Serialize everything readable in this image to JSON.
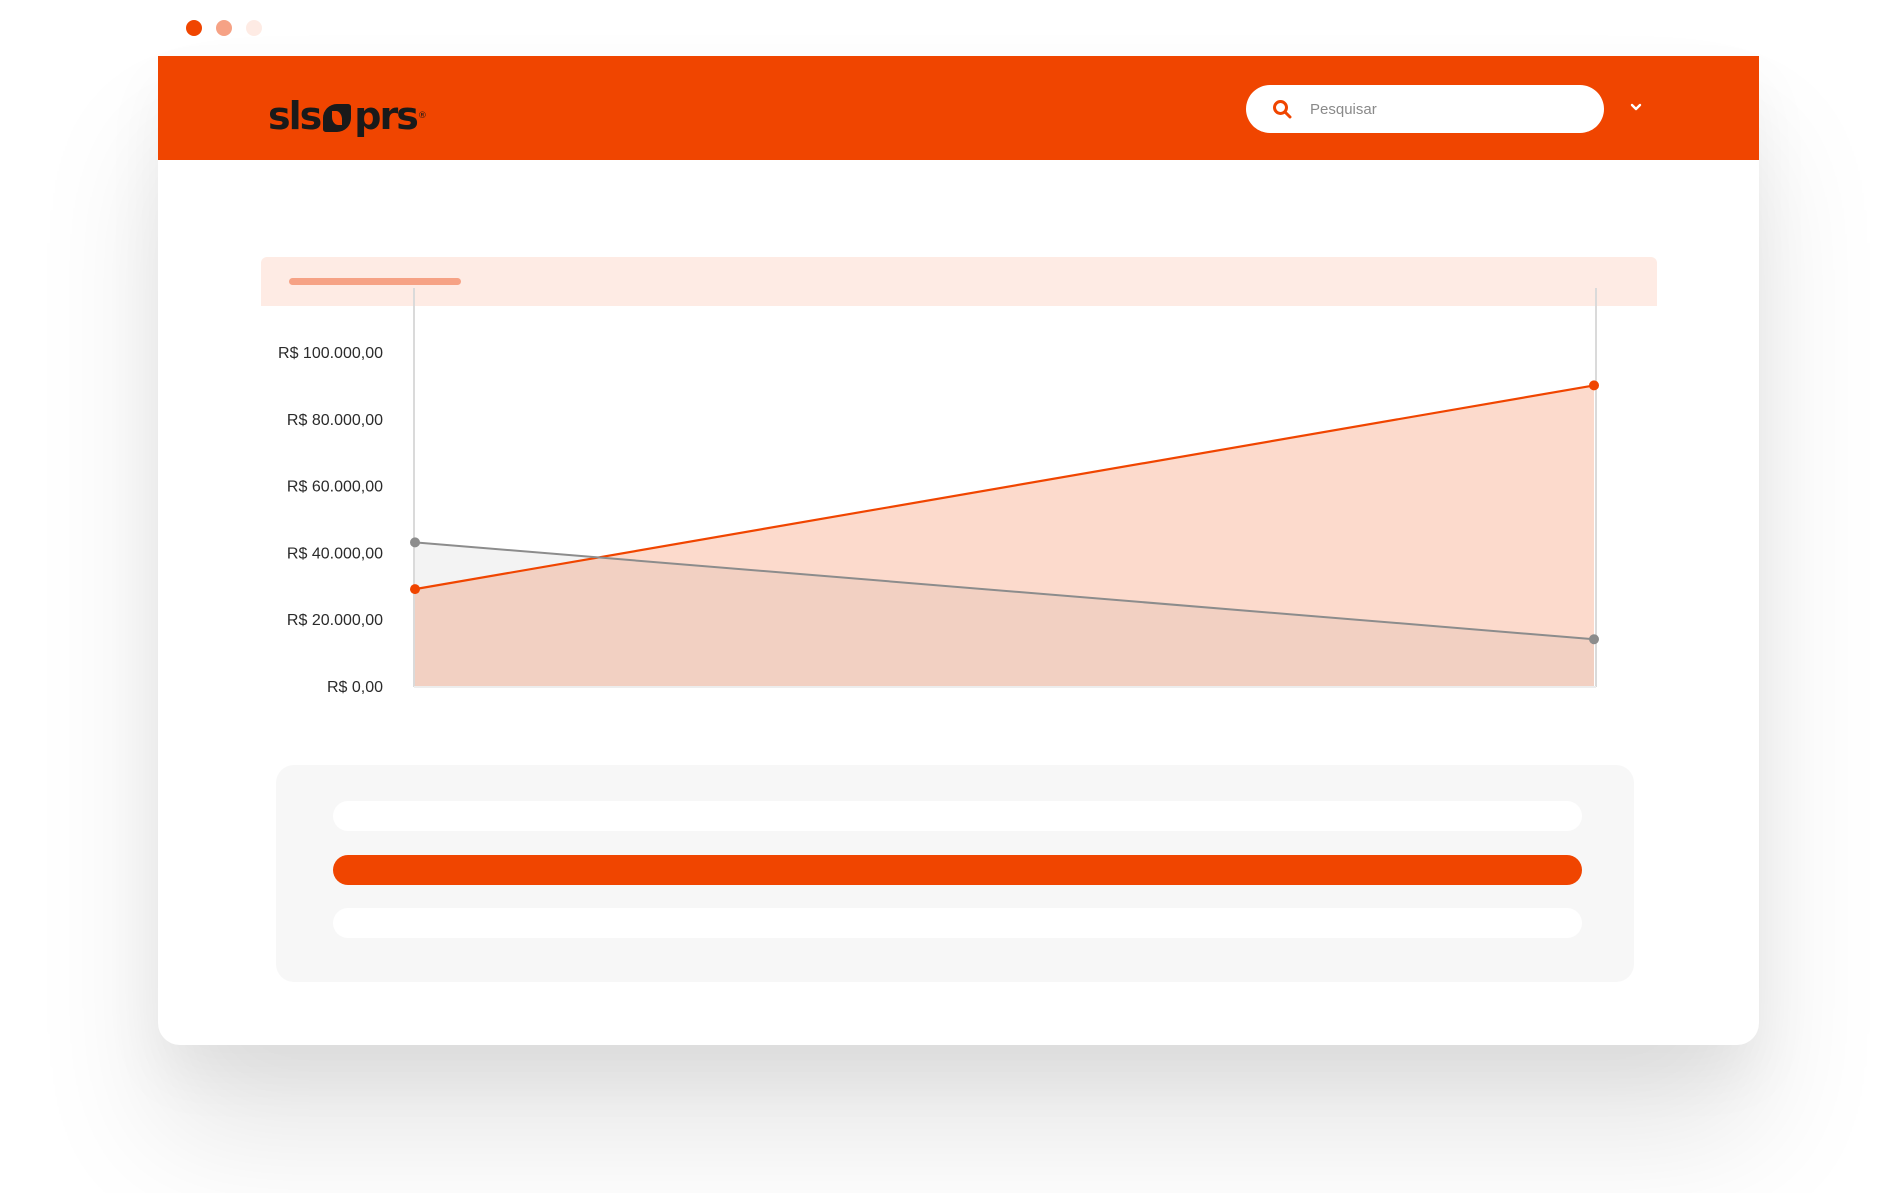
{
  "window_controls": [
    {
      "name": "close",
      "color": "#F04500"
    },
    {
      "name": "minimize",
      "color": "#F6A285"
    },
    {
      "name": "maximize",
      "color": "#FEEBE4"
    }
  ],
  "colors": {
    "brand": "#F04500",
    "brand_light": "#FEEBE4",
    "brand_mid": "#F6A285",
    "series_gray": "#8C8C8C"
  },
  "header": {
    "logo": {
      "part1": "sls",
      "part2": "prs",
      "reg": "®"
    },
    "search": {
      "placeholder": "Pesquisar",
      "icon": "search-icon"
    },
    "menu_icon": "chevron-down-icon"
  },
  "chart_data": {
    "type": "area",
    "x": [
      0,
      1
    ],
    "yticks": [
      "R$ 100.000,00",
      "R$ 80.000,00",
      "R$ 60.000,00",
      "R$ 40.000,00",
      "R$ 20.000,00",
      "R$ 0,00"
    ],
    "ytick_values": [
      100000,
      80000,
      60000,
      40000,
      20000,
      0
    ],
    "ylim": [
      0,
      100000
    ],
    "series": [
      {
        "key": "orange",
        "color": "#F04500",
        "values": [
          29000,
          90000
        ]
      },
      {
        "key": "gray",
        "color": "#8C8C8C",
        "values": [
          43000,
          14000
        ]
      }
    ],
    "grid": false
  },
  "list": {
    "rows": [
      {
        "state": "inactive"
      },
      {
        "state": "active"
      },
      {
        "state": "inactive"
      }
    ]
  }
}
